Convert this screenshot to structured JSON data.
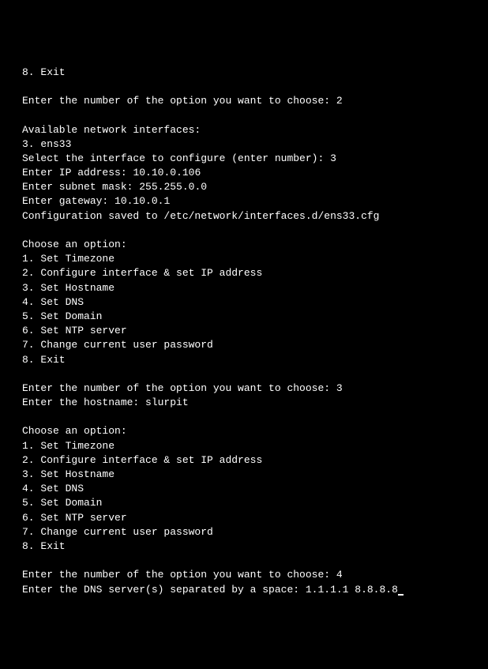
{
  "colors": {
    "background": "#000000",
    "foreground": "#ffffff"
  },
  "prev_menu_tail": {
    "item8": "8. Exit"
  },
  "prompt1": {
    "text": "Enter the number of the option you want to choose: ",
    "value": "2"
  },
  "network_section": {
    "header": "Available network interfaces:",
    "interface": "3. ens33",
    "select_prompt": "Select the interface to configure (enter number): ",
    "select_value": "3",
    "ip_prompt": "Enter IP address: ",
    "ip_value": "10.10.0.106",
    "mask_prompt": "Enter subnet mask: ",
    "mask_value": "255.255.0.0",
    "gateway_prompt": "Enter gateway: ",
    "gateway_value": "10.10.0.1",
    "saved": "Configuration saved to /etc/network/interfaces.d/ens33.cfg"
  },
  "menu2": {
    "header": "Choose an option:",
    "item1": "1. Set Timezone",
    "item2": "2. Configure interface & set IP address",
    "item3": "3. Set Hostname",
    "item4": "4. Set DNS",
    "item5": "5. Set Domain",
    "item6": "6. Set NTP server",
    "item7": "7. Change current user password",
    "item8": "8. Exit"
  },
  "prompt2": {
    "text": "Enter the number of the option you want to choose: ",
    "value": "3"
  },
  "hostname": {
    "prompt": "Enter the hostname: ",
    "value": "slurpit"
  },
  "menu3": {
    "header": "Choose an option:",
    "item1": "1. Set Timezone",
    "item2": "2. Configure interface & set IP address",
    "item3": "3. Set Hostname",
    "item4": "4. Set DNS",
    "item5": "5. Set Domain",
    "item6": "6. Set NTP server",
    "item7": "7. Change current user password",
    "item8": "8. Exit"
  },
  "prompt3": {
    "text": "Enter the number of the option you want to choose: ",
    "value": "4"
  },
  "dns": {
    "prompt": "Enter the DNS server(s) separated by a space: ",
    "value": "1.1.1.1 8.8.8.8"
  }
}
